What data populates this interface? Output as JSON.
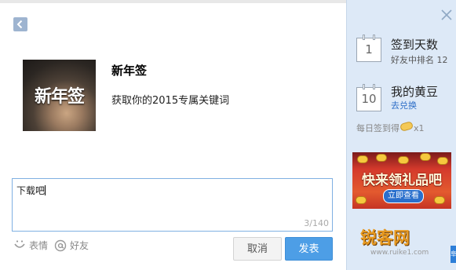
{
  "share": {
    "title": "新年签",
    "subtitle": "获取你的2015专属关键词",
    "thumbnail_text": "新年签"
  },
  "compose": {
    "text": "下载吧",
    "counter": "3/140"
  },
  "tools": {
    "emoji_label": "表情",
    "friend_label": "好友"
  },
  "actions": {
    "cancel_label": "取消",
    "post_label": "发表"
  },
  "sidebar": {
    "checkin": {
      "day": "1",
      "title": "签到天数",
      "sub": "好友中排名 12"
    },
    "beans": {
      "day": "10",
      "title": "我的黄豆",
      "link": "去兑换"
    },
    "daily_note": "每日签到得",
    "daily_reward": "x1",
    "ad": {
      "title": "快来领礼品吧",
      "button": "立即查看"
    },
    "watermark": "锐客网",
    "watermark_url": "www.ruike1.com",
    "edge_tab": "阜"
  },
  "colors": {
    "accent": "#4d9ee6",
    "sidebar_bg": "#dde9f7",
    "link": "#2e6fc7",
    "input_border": "#7fb0e2"
  },
  "icons": [
    "back-arrow-icon",
    "smiley-icon",
    "at-icon",
    "close-icon",
    "calendar-icon",
    "bean-icon"
  ]
}
